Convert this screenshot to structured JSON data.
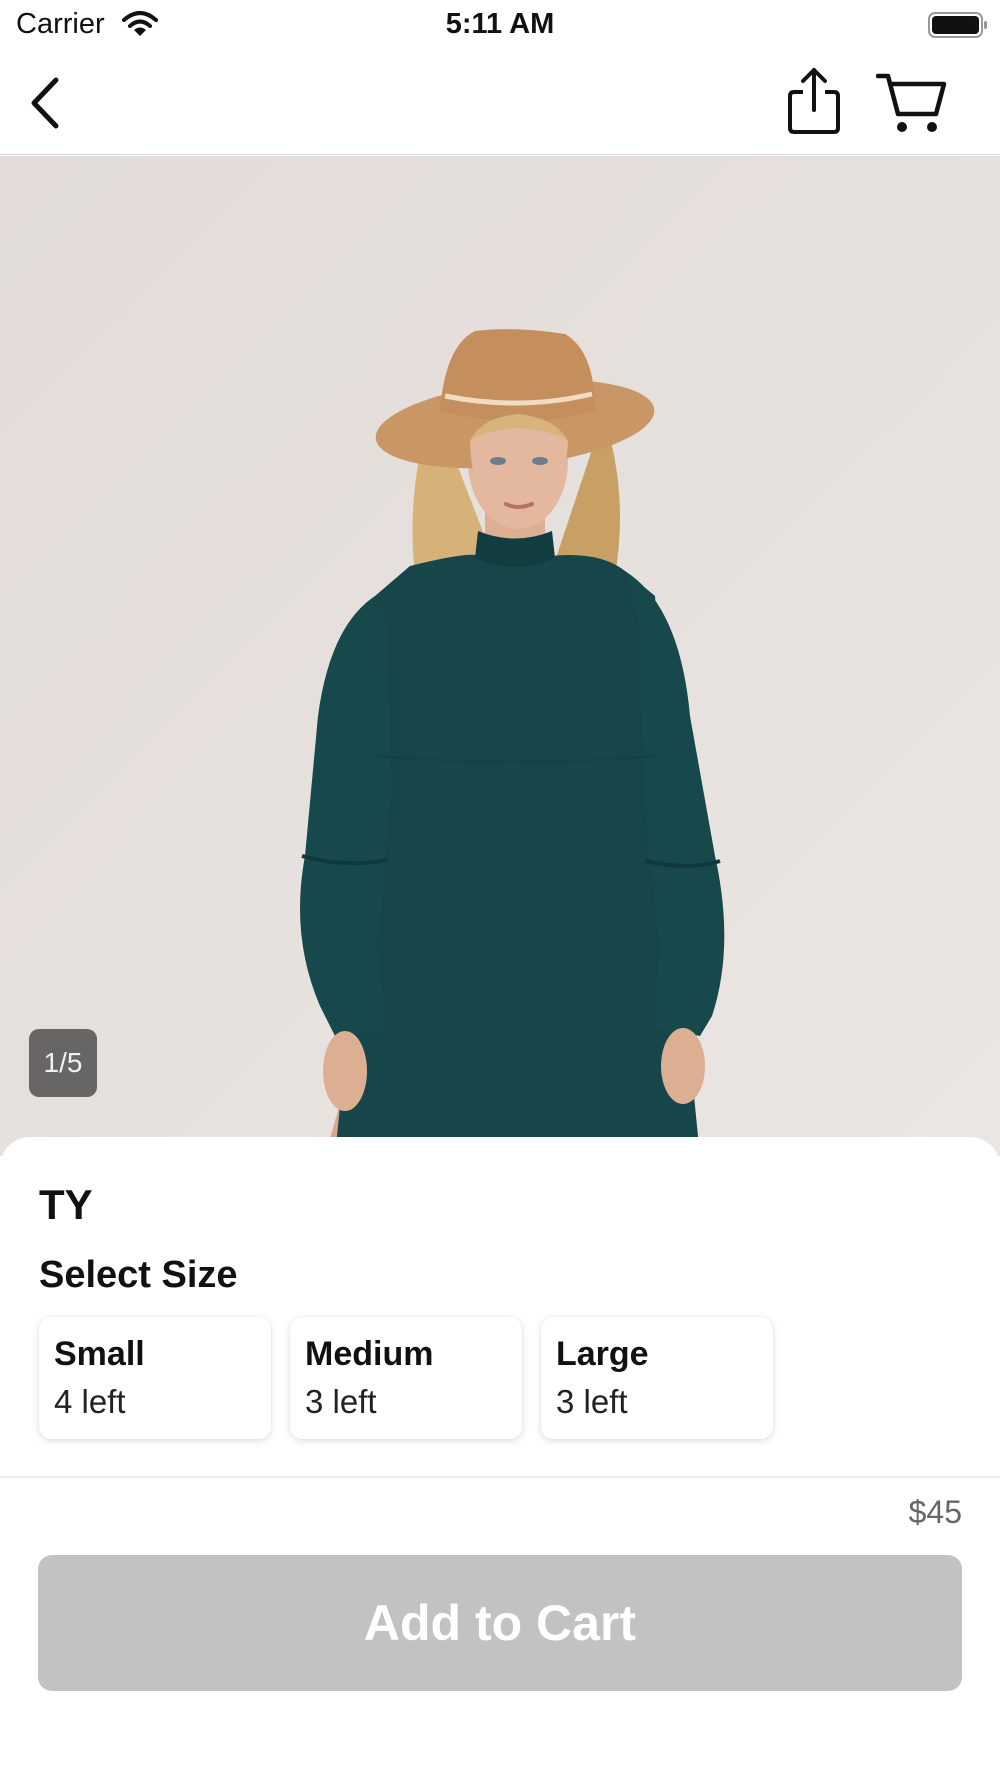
{
  "status_bar": {
    "carrier": "Carrier",
    "time": "5:11 AM"
  },
  "nav": {
    "back_icon": "chevron-left-icon",
    "share_icon": "share-icon",
    "cart_icon": "cart-icon"
  },
  "gallery": {
    "page_indicator": "1/5"
  },
  "product": {
    "brand": "TY",
    "price": "$45"
  },
  "size_section": {
    "title": "Select Size",
    "options": [
      {
        "name": "Small",
        "stock": "4 left"
      },
      {
        "name": "Medium",
        "stock": "3 left"
      },
      {
        "name": "Large",
        "stock": "3 left"
      }
    ]
  },
  "cart_button": {
    "label": "Add to Cart",
    "state": "disabled"
  },
  "colors": {
    "button_disabled": "#c2c2c2",
    "dress": "#16464a",
    "hat": "#c99666",
    "backdrop": "#e6e0dd"
  }
}
